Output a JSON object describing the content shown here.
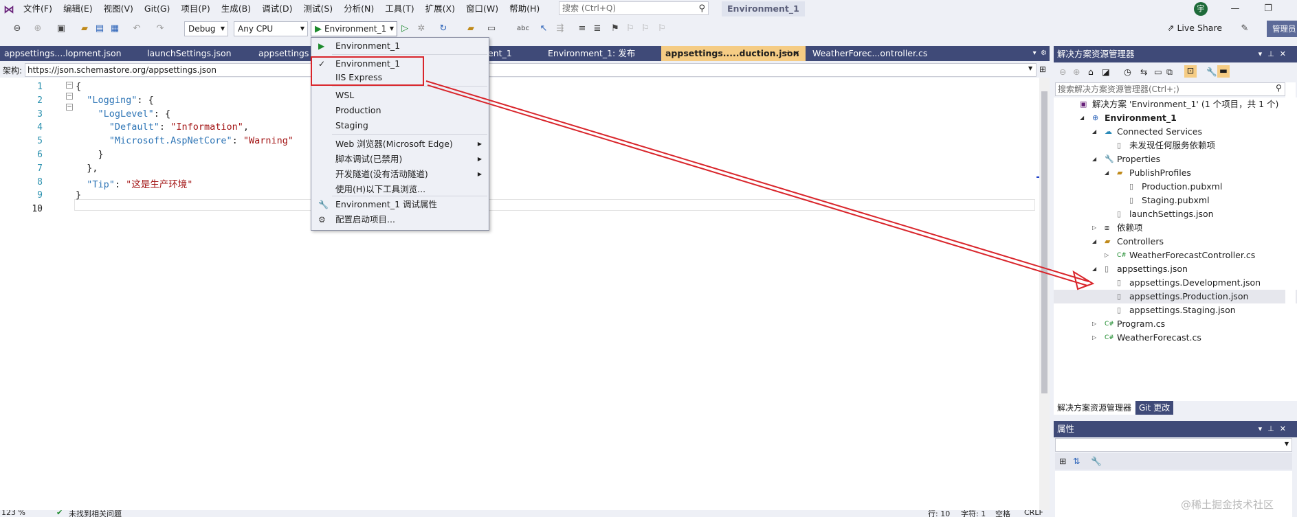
{
  "menubar": {
    "items": [
      "文件(F)",
      "编辑(E)",
      "视图(V)",
      "Git(G)",
      "项目(P)",
      "生成(B)",
      "调试(D)",
      "测试(S)",
      "分析(N)",
      "工具(T)",
      "扩展(X)",
      "窗口(W)",
      "帮助(H)"
    ],
    "search_placeholder": "搜索 (Ctrl+Q)",
    "solution_title": "Environment_1",
    "avatar_initial": "宇"
  },
  "toolbar": {
    "config": "Debug",
    "platform": "Any CPU",
    "run_target": "Environment_1",
    "live_share": "Live Share",
    "admin": "管理员"
  },
  "tabs": [
    {
      "label": "appsettings....lopment.json"
    },
    {
      "label": "launchSettings.json"
    },
    {
      "label": "appsettings.j"
    },
    {
      "label": "ent_1"
    },
    {
      "label": "Environment_1: 发布"
    },
    {
      "label": "appsettings.....duction.json",
      "active": true
    },
    {
      "label": "WeatherForec...ontroller.cs"
    }
  ],
  "schema": {
    "label": "架构:",
    "url": "https://json.schemastore.org/appsettings.json"
  },
  "editor": {
    "line_numbers": [
      "1",
      "2",
      "3",
      "4",
      "5",
      "6",
      "7",
      "8",
      "9",
      "10"
    ],
    "lines": [
      [
        {
          "t": "{",
          "c": "p"
        }
      ],
      [
        {
          "t": "  \"Logging\"",
          "c": "k"
        },
        {
          "t": ": {",
          "c": "p"
        }
      ],
      [
        {
          "t": "    \"LogLevel\"",
          "c": "k"
        },
        {
          "t": ": {",
          "c": "p"
        }
      ],
      [
        {
          "t": "      \"Default\"",
          "c": "k"
        },
        {
          "t": ": ",
          "c": "p"
        },
        {
          "t": "\"Information\"",
          "c": "s"
        },
        {
          "t": ",",
          "c": "p"
        }
      ],
      [
        {
          "t": "      \"Microsoft.AspNetCore\"",
          "c": "k"
        },
        {
          "t": ": ",
          "c": "p"
        },
        {
          "t": "\"Warning\"",
          "c": "s"
        }
      ],
      [
        {
          "t": "    }",
          "c": "p"
        }
      ],
      [
        {
          "t": "  },",
          "c": "p"
        }
      ],
      [
        {
          "t": "  \"Tip\"",
          "c": "k"
        },
        {
          "t": ": ",
          "c": "p"
        },
        {
          "t": "\"这是生产环境\"",
          "c": "s"
        }
      ],
      [
        {
          "t": "}",
          "c": "p"
        }
      ],
      []
    ]
  },
  "status": {
    "zoom": "123 %",
    "issues": "未找到相关问题",
    "line": "行: 10",
    "char": "字符: 1",
    "spaces": "空格",
    "eol": "CRLF"
  },
  "dropdown": {
    "items": [
      {
        "label": "Environment_1",
        "icon": "play-icon"
      },
      {
        "label": "Environment_1",
        "icon": "check-icon"
      },
      {
        "label": "IIS Express"
      },
      {
        "label": "WSL"
      },
      {
        "label": "Production"
      },
      {
        "label": "Staging"
      },
      {
        "label": "Web 浏览器(Microsoft Edge)",
        "submenu": true
      },
      {
        "label": "脚本调试(已禁用)",
        "submenu": true
      },
      {
        "label": "开发隧道(没有活动隧道)",
        "submenu": true
      },
      {
        "label": "使用(H)以下工具浏览..."
      },
      {
        "label": "Environment_1 调试属性",
        "icon": "wrench-icon"
      },
      {
        "label": "配置启动项目...",
        "icon": "gear-icon"
      }
    ]
  },
  "solution_explorer": {
    "title": "解决方案资源管理器",
    "search_placeholder": "搜索解决方案资源管理器(Ctrl+;)",
    "tree": [
      {
        "label": "解决方案 'Environment_1' (1 个项目，共 1 个)",
        "icon": "solution-icon",
        "level": 0
      },
      {
        "label": "Environment_1",
        "icon": "project-icon",
        "level": 1,
        "bold": true
      },
      {
        "label": "Connected Services",
        "icon": "connected-services-icon",
        "level": 2
      },
      {
        "label": "未发现任何服务依赖项",
        "icon": "file-icon",
        "level": 3
      },
      {
        "label": "Properties",
        "icon": "properties-icon",
        "level": 2
      },
      {
        "label": "PublishProfiles",
        "icon": "folder-icon",
        "level": 3
      },
      {
        "label": "Production.pubxml",
        "icon": "file-icon",
        "level": 4
      },
      {
        "label": "Staging.pubxml",
        "icon": "file-icon",
        "level": 4
      },
      {
        "label": "launchSettings.json",
        "icon": "json-icon",
        "level": 3
      },
      {
        "label": "依赖项",
        "icon": "dependencies-icon",
        "level": 2
      },
      {
        "label": "Controllers",
        "icon": "folder-icon",
        "level": 2
      },
      {
        "label": "WeatherForecastController.cs",
        "icon": "csharp-icon",
        "level": 3
      },
      {
        "label": "appsettings.json",
        "icon": "json-icon",
        "level": 2
      },
      {
        "label": "appsettings.Development.json",
        "icon": "json-icon",
        "level": 3
      },
      {
        "label": "appsettings.Production.json",
        "icon": "json-icon",
        "level": 3,
        "selected": true
      },
      {
        "label": "appsettings.Staging.json",
        "icon": "json-icon",
        "level": 3
      },
      {
        "label": "Program.cs",
        "icon": "csharp-icon",
        "level": 2
      },
      {
        "label": "WeatherForecast.cs",
        "icon": "csharp-icon",
        "level": 2
      }
    ],
    "bottom_tabs": [
      "解决方案资源管理器",
      "Git 更改"
    ]
  },
  "properties": {
    "title": "属性"
  },
  "watermark": "@稀土掘金技术社区",
  "colors": {
    "accent": "#3f4a78",
    "active_tab": "#f5cc84",
    "annotation": "#d9252b"
  }
}
